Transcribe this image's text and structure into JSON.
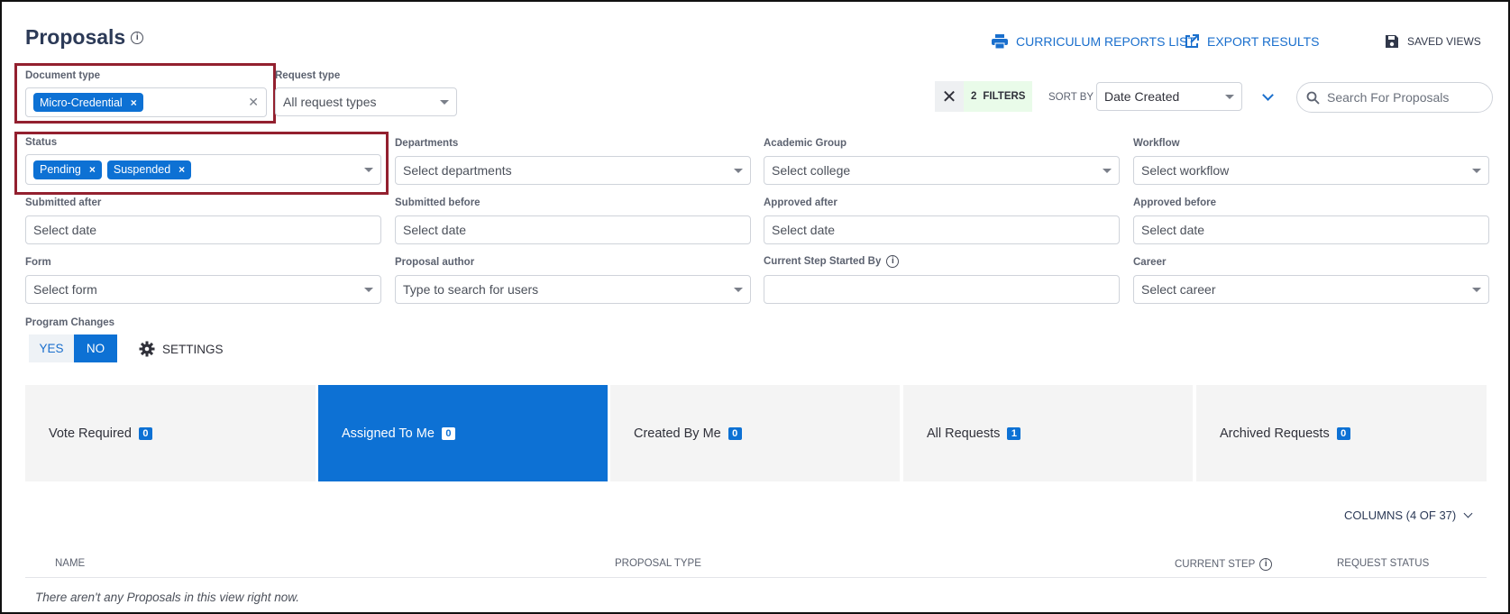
{
  "header": {
    "title": "Proposals",
    "info_glyph": "i",
    "links": {
      "reports": "CURRICULUM REPORTS LIST",
      "export": "EXPORT RESULTS",
      "saved_views": "SAVED VIEWS"
    }
  },
  "filters": {
    "document_type": {
      "label": "Document type",
      "chips": [
        "Micro-Credential"
      ]
    },
    "request_type": {
      "label": "Request type",
      "placeholder": "All request types"
    },
    "status": {
      "label": "Status",
      "chips": [
        "Pending",
        "Suspended"
      ]
    },
    "departments": {
      "label": "Departments",
      "placeholder": "Select departments"
    },
    "academic_group": {
      "label": "Academic Group",
      "placeholder": "Select college"
    },
    "workflow": {
      "label": "Workflow",
      "placeholder": "Select workflow"
    },
    "submitted_after": {
      "label": "Submitted after",
      "placeholder": "Select date"
    },
    "submitted_before": {
      "label": "Submitted before",
      "placeholder": "Select date"
    },
    "approved_after": {
      "label": "Approved after",
      "placeholder": "Select date"
    },
    "approved_before": {
      "label": "Approved before",
      "placeholder": "Select date"
    },
    "form": {
      "label": "Form",
      "placeholder": "Select form"
    },
    "proposal_author": {
      "label": "Proposal author",
      "placeholder": "Type to search for users"
    },
    "current_step_started_by": {
      "label": "Current Step Started By",
      "value": ""
    },
    "career": {
      "label": "Career",
      "placeholder": "Select career"
    },
    "program_changes": {
      "label": "Program Changes",
      "yes": "YES",
      "no": "NO",
      "selected": "NO"
    },
    "settings_label": "SETTINGS"
  },
  "toolbar": {
    "active_filters_count": "2",
    "filters_label": "FILTERS",
    "sort_by_label": "SORT BY",
    "sort_value": "Date Created",
    "search_placeholder": "Search For Proposals"
  },
  "tabs": [
    {
      "label": "Vote Required",
      "count": "0",
      "active": false
    },
    {
      "label": "Assigned To Me",
      "count": "0",
      "active": true
    },
    {
      "label": "Created By Me",
      "count": "0",
      "active": false
    },
    {
      "label": "All Requests",
      "count": "1",
      "active": false
    },
    {
      "label": "Archived Requests",
      "count": "0",
      "active": false
    }
  ],
  "table": {
    "columns_toggle": "COLUMNS (4 OF 37)",
    "headers": [
      "NAME",
      "PROPOSAL TYPE",
      "CURRENT STEP",
      "REQUEST STATUS"
    ],
    "empty_message": "There aren't any Proposals in this view right now."
  },
  "colors": {
    "accent": "#0d71d4",
    "highlight_border": "#93202f",
    "tile_bg": "#f4f4f4"
  },
  "icons": [
    "info-icon",
    "printer-icon",
    "external-link-icon",
    "save-icon",
    "close-icon",
    "chevron-down-icon",
    "search-icon",
    "gear-icon"
  ]
}
